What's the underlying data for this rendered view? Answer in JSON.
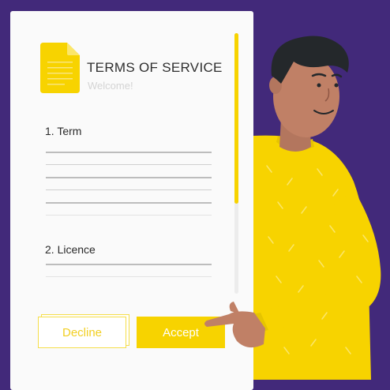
{
  "dialog": {
    "title": "TERMS OF SERVICE",
    "subtitle": "Welcome!"
  },
  "sections": [
    {
      "heading": "1. Term"
    },
    {
      "heading": "2. Licence"
    }
  ],
  "buttons": {
    "decline_label": "Decline",
    "accept_label": "Accept"
  },
  "colors": {
    "background": "#42297a",
    "accent": "#f7d300",
    "card": "#fafafa"
  },
  "icons": {
    "document": "document-icon"
  }
}
